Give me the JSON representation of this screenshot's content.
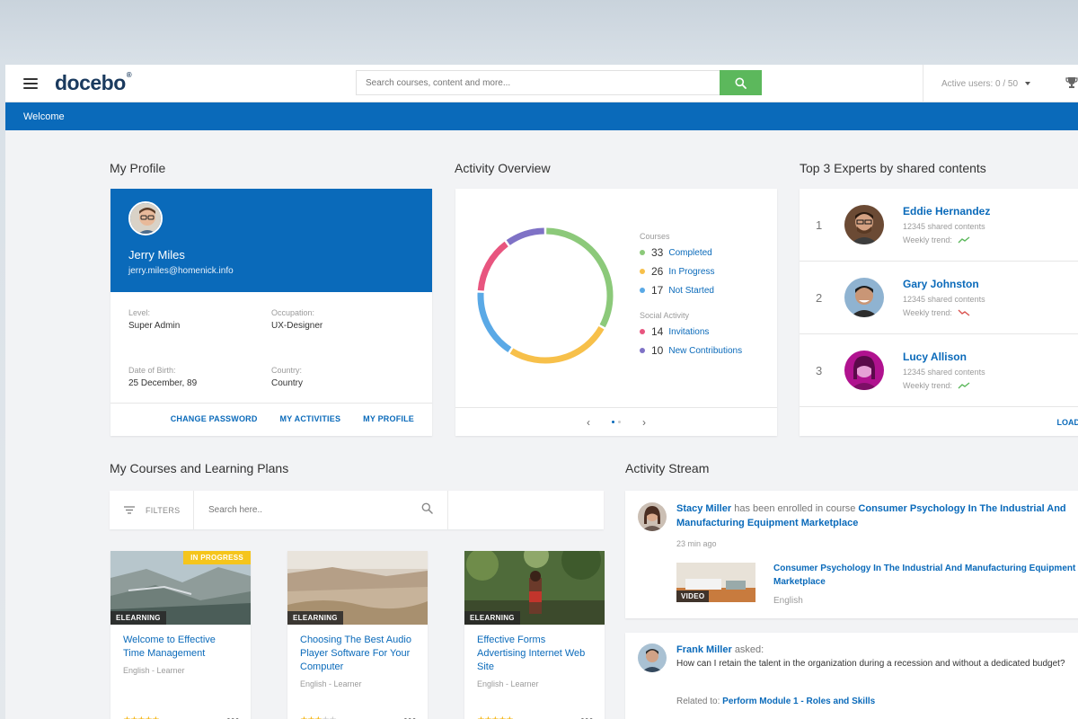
{
  "header": {
    "logo": "docebo",
    "logo_mark": "®",
    "search_placeholder": "Search courses, content and more...",
    "active_users_label": "Active users:",
    "active_users_value": "0 / 50"
  },
  "welcome_bar": {
    "label": "Welcome"
  },
  "profile": {
    "section_title": "My Profile",
    "name": "Jerry Miles",
    "email": "jerry.miles@homenick.info",
    "fields": {
      "level_label": "Level:",
      "level_value": "Super Admin",
      "occupation_label": "Occupation:",
      "occupation_value": "UX-Designer",
      "dob_label": "Date of Birth:",
      "dob_value": "25 December, 89",
      "country_label": "Country:",
      "country_value": "Country"
    },
    "links": {
      "change_password": "CHANGE PASSWORD",
      "my_activities": "MY ACTIVITIES",
      "my_profile": "MY PROFILE"
    }
  },
  "activity": {
    "section_title": "Activity Overview",
    "courses_heading": "Courses",
    "social_heading": "Social Activity",
    "courses": [
      {
        "value": "33",
        "label": "Completed",
        "color": "#8cc97a"
      },
      {
        "value": "26",
        "label": "In Progress",
        "color": "#f7c04a"
      },
      {
        "value": "17",
        "label": "Not Started",
        "color": "#5aa9e6"
      }
    ],
    "social": [
      {
        "value": "14",
        "label": "Invitations",
        "color": "#e8557f"
      },
      {
        "value": "10",
        "label": "New Contributions",
        "color": "#7f72c6"
      }
    ]
  },
  "experts": {
    "section_title": "Top 3 Experts by shared contents",
    "weekly_label": "Weekly trend:",
    "items": [
      {
        "rank": "1",
        "name": "Eddie Hernandez",
        "shared": "12345 shared contents",
        "trend": "up"
      },
      {
        "rank": "2",
        "name": "Gary Johnston",
        "shared": "12345 shared contents",
        "trend": "down"
      },
      {
        "rank": "3",
        "name": "Lucy Allison",
        "shared": "12345 shared contents",
        "trend": "up"
      }
    ],
    "load_label": "LOAD"
  },
  "courses": {
    "section_title": "My Courses and Learning Plans",
    "filters_label": "FILTERS",
    "search_placeholder": "Search here..",
    "items": [
      {
        "tag": "ELEARNING",
        "badge": "IN PROGRESS",
        "title": "Welcome to Effective Time Management",
        "meta": "English - Learner",
        "rating": 5
      },
      {
        "tag": "ELEARNING",
        "badge": "",
        "title": "Choosing The Best Audio Player Software For Your Computer",
        "meta": "English - Learner",
        "rating": 3
      },
      {
        "tag": "ELEARNING",
        "badge": "",
        "title": "Effective Forms Advertising Internet Web Site",
        "meta": "English - Learner",
        "rating": 5
      }
    ]
  },
  "stream": {
    "section_title": "Activity Stream",
    "item1": {
      "user": "Stacy Miller",
      "action": "has been enrolled in course",
      "course": "Consumer Psychology In The Industrial And Manufacturing Equipment Marketplace",
      "time": "23 min ago",
      "thumb_tag": "VIDEO",
      "content_title": "Consumer Psychology In The Industrial And Manufacturing Equipment Marketplace",
      "content_lang": "English"
    },
    "item2": {
      "user": "Frank Miller",
      "action": "asked:",
      "question": "How can I retain the talent in the organization during a recession and without a dedicated budget?",
      "related_label": "Related to:",
      "related_link": "Perform Module 1 - Roles and Skills"
    }
  }
}
